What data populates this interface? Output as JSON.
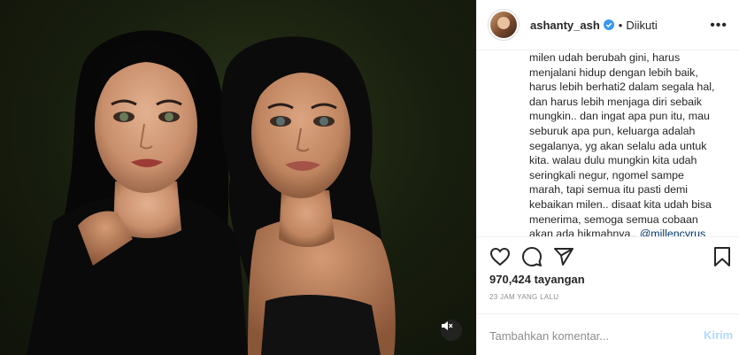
{
  "post": {
    "username": "ashanty_ash",
    "follow_status": "Diikuti",
    "dot": "•",
    "more": "•••",
    "caption_lines": [
      "milen udah berubah gini, harus",
      "menjalani hidup dengan lebih baik,",
      "harus lebih berhati2 dalam segala hal,",
      "dan harus lebih menjaga diri sebaik",
      "mungkin.. dan ingat apa pun itu, mau",
      "seburuk apa pun, keluarga adalah",
      "segalanya, yg akan selalu ada untuk",
      "kita. walau dulu mungkin kita udah",
      "seringkali negur, ngomel sampe",
      "marah, tapi semua itu pasti demi",
      "kebaikan milen.. disaat kita udah bisa",
      "menerima, semoga semua cobaan"
    ],
    "caption_last": "akan ada hikmahnya..",
    "caption_mention": "@millencyrus",
    "views": "970,424 tayangan",
    "time_ago": "23 JAM YANG LALU"
  },
  "comment": {
    "placeholder": "Tambahkan komentar...",
    "post_label": "Kirim"
  },
  "icons": {
    "like": "heart-icon",
    "comment": "comment-icon",
    "share": "share-icon",
    "save": "bookmark-icon",
    "mute": "speaker-muted-icon",
    "verified": "verified-badge-icon"
  },
  "colors": {
    "verified": "#3897f0",
    "link": "#00376b",
    "post_disabled": "#b3dbff",
    "muted_text": "#8e8e8e"
  }
}
